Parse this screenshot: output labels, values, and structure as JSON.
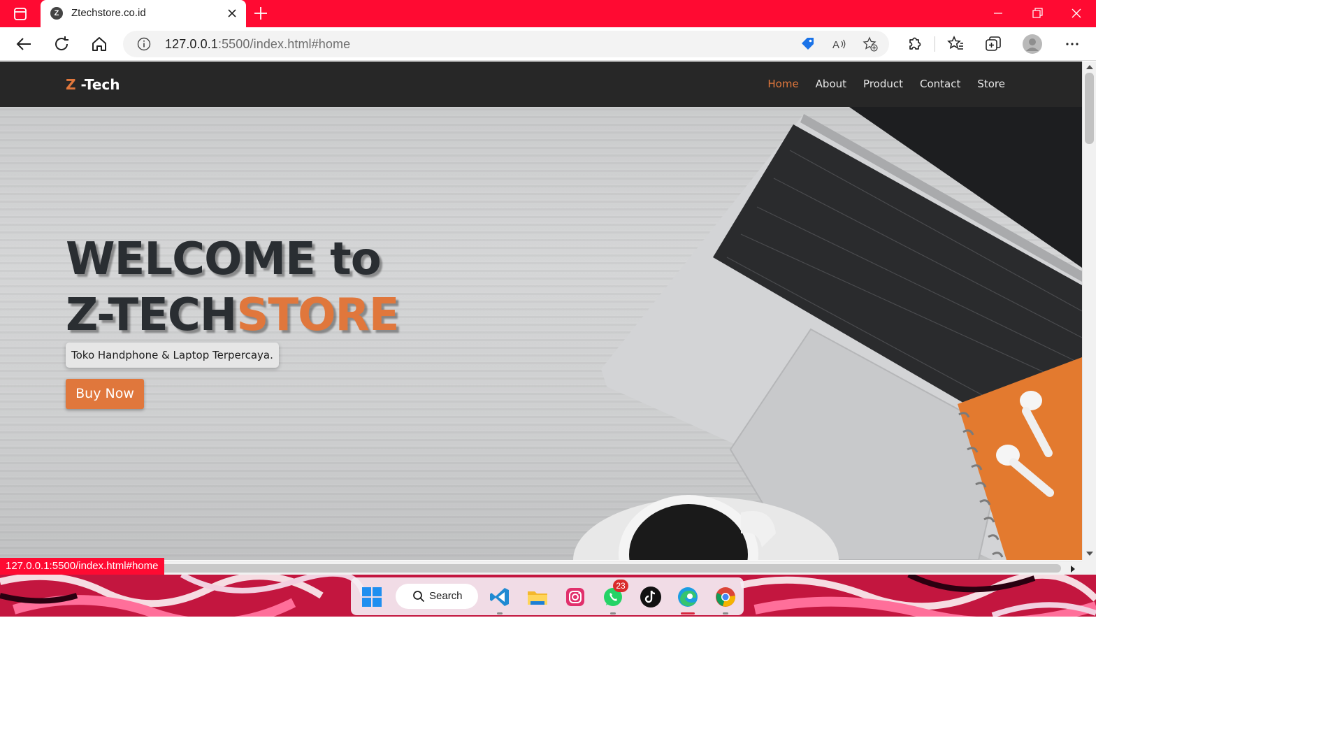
{
  "browser": {
    "tab_title": "Ztechstore.co.id",
    "tab_favicon": "Z",
    "url_host": "127.0.0.1",
    "url_rest": ":5500/index.html#home",
    "status_url": "127.0.0.1:5500/index.html#home"
  },
  "site": {
    "brand_accent": "Z",
    "brand_rest": " -Tech",
    "nav": [
      {
        "label": "Home",
        "active": true
      },
      {
        "label": "About",
        "active": false
      },
      {
        "label": "Product",
        "active": false
      },
      {
        "label": "Contact",
        "active": false
      },
      {
        "label": "Store",
        "active": false
      }
    ],
    "hero": {
      "line1": "WELCOME to",
      "line2_dark": "Z-TECH",
      "line2_orange": "STORE",
      "tagline": "Toko Handphone & Laptop Terpercaya.",
      "cta_label": "Buy Now"
    }
  },
  "taskbar": {
    "search_label": "Search",
    "whatsapp_badge": "23"
  },
  "colors": {
    "titlebar": "#ff0a32",
    "accent_orange": "#e0773c",
    "navbar": "#272727"
  }
}
